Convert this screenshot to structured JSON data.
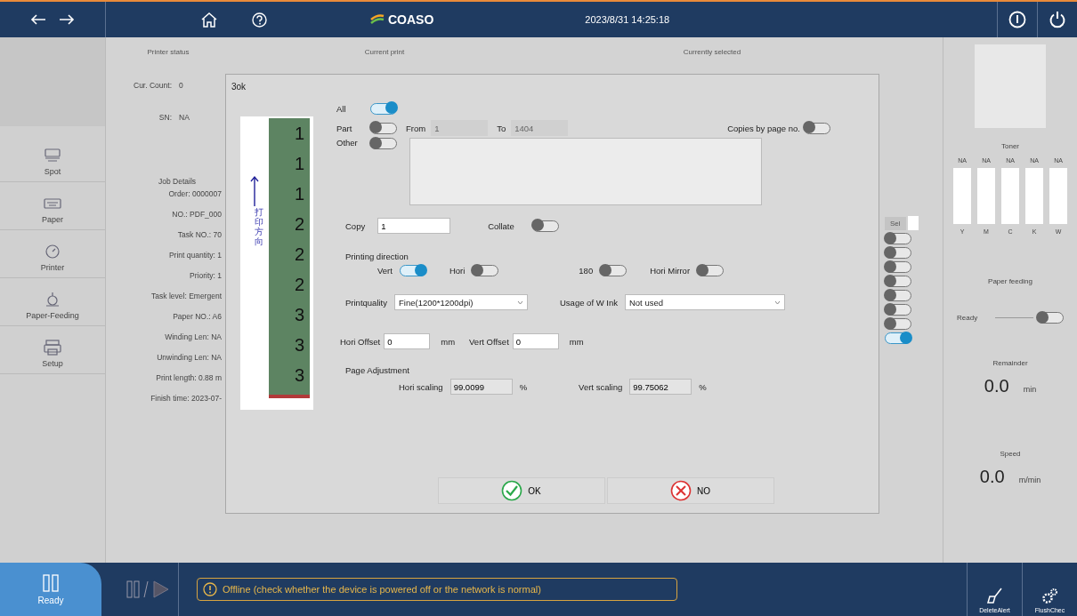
{
  "top_bar": {
    "logo": "COASO",
    "datetime": "2023/8/31 14:25:18"
  },
  "sidebar": {
    "items": [
      {
        "label": "Spot",
        "kind": "spot",
        "selected": false
      },
      {
        "label": "Paper",
        "kind": "paper",
        "selected": false
      },
      {
        "label": "Printer",
        "kind": "printer",
        "selected": false
      },
      {
        "label": "Paper-Feeding",
        "kind": "feeding",
        "selected": false
      },
      {
        "label": "Setup",
        "kind": "setup",
        "selected": false
      }
    ]
  },
  "column_headers": [
    "Printer status",
    "Current print",
    "Currently selected"
  ],
  "printer_status": [
    {
      "label": "Cur. Count:",
      "value": "0"
    },
    {
      "label": "SN:",
      "value": "NA"
    }
  ],
  "job_details": {
    "title": "Job Details",
    "fields": [
      "Order: 0000007",
      "NO.: PDF_000",
      "Task NO.: 70",
      "Print quantity: 1",
      "Priority: 1",
      "Task level: Emergent",
      "Paper NO.: A6",
      "Winding Len: NA",
      "Unwinding Len: NA",
      "Print length: 0.88 m",
      "Finish time: 2023-07-"
    ]
  },
  "dialog": {
    "title": "3ok",
    "preview": {
      "direction_label": "打印方向",
      "pages": [
        "1",
        "1",
        "1",
        "2",
        "2",
        "2",
        "3",
        "3",
        "3"
      ]
    },
    "all": {
      "label": "All",
      "on": true
    },
    "part": {
      "label": "Part",
      "on": false,
      "from_label": "From",
      "from": "1",
      "to_label": "To",
      "to": "1404"
    },
    "copies_by_page": {
      "label": "Copies by page no.",
      "on": false
    },
    "other": {
      "label": "Other",
      "on": false
    },
    "copy": {
      "label": "Copy",
      "value": "1"
    },
    "collate": {
      "label": "Collate",
      "on": false
    },
    "printing_direction": {
      "title": "Printing direction",
      "options": [
        {
          "label": "Vert",
          "on": true
        },
        {
          "label": "Hori",
          "on": false
        },
        {
          "label": "180",
          "on": false
        },
        {
          "label": "Hori Mirror",
          "on": false
        }
      ]
    },
    "print_quality": {
      "label": "Printquality",
      "value": "Fine(1200*1200dpi)"
    },
    "w_ink": {
      "label": "Usage of W Ink",
      "value": "Not used"
    },
    "hori_offset": {
      "label": "Hori Offset",
      "value": "0",
      "unit": "mm"
    },
    "vert_offset": {
      "label": "Vert Offset",
      "value": "0",
      "unit": "mm"
    },
    "page_adjustment": {
      "title": "Page Adjustment",
      "hori_label": "Hori scaling",
      "hori_value": "99.0099",
      "vert_label": "Vert scaling",
      "vert_value": "99.75062",
      "unit": "%"
    },
    "buttons": [
      {
        "label": "OK",
        "kind": "ok"
      },
      {
        "label": "NO",
        "kind": "no"
      }
    ]
  },
  "select_column": {
    "label": "Sel",
    "checked": false,
    "toggles": [
      {
        "on": false
      },
      {
        "on": false
      },
      {
        "on": false
      },
      {
        "on": false
      },
      {
        "on": false
      },
      {
        "on": false
      },
      {
        "on": false
      },
      {
        "on": true
      }
    ]
  },
  "right_panel": {
    "toner": {
      "title": "Toner",
      "channels": [
        {
          "value": "NA",
          "label": "Y"
        },
        {
          "value": "NA",
          "label": "M"
        },
        {
          "value": "NA",
          "label": "C"
        },
        {
          "value": "NA",
          "label": "K"
        },
        {
          "value": "NA",
          "label": "W"
        }
      ]
    },
    "paper_feeding": {
      "title": "Paper feeding",
      "label": "Ready",
      "on": false
    },
    "remainder": {
      "title": "Remainder",
      "value": "0.0",
      "unit": "min"
    },
    "speed": {
      "title": "Speed",
      "value": "0.0",
      "unit": "m/min"
    }
  },
  "bottom_bar": {
    "status": "Ready",
    "message": "Offline (check whether the device is powered off or the network is normal)",
    "buttons": [
      {
        "label": "DeleteAlert",
        "kind": "broom"
      },
      {
        "label": "FlushChec",
        "kind": "gears"
      }
    ]
  }
}
